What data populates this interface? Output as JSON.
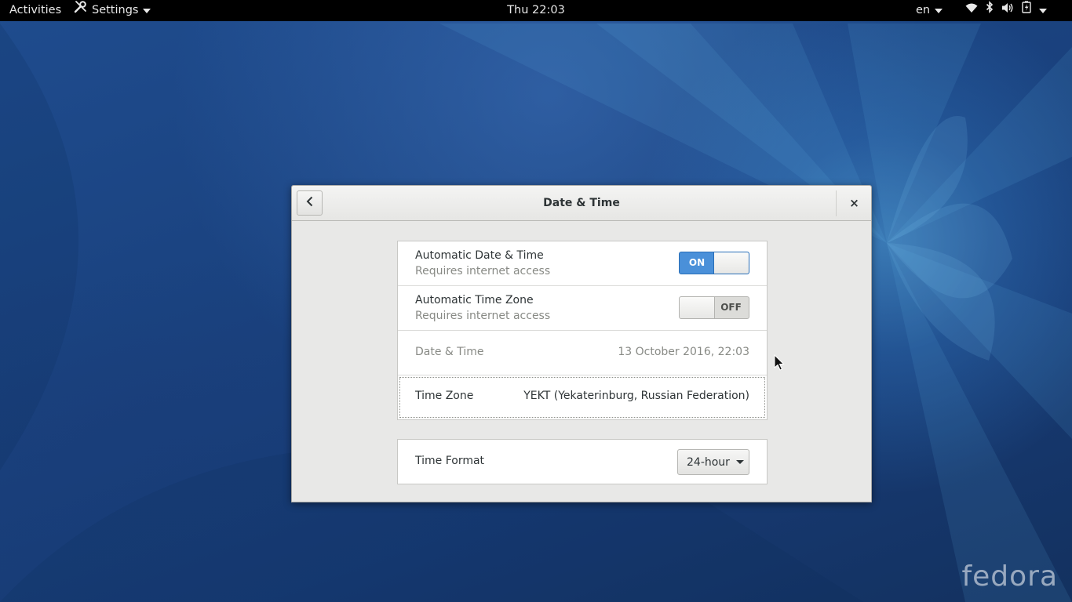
{
  "topbar": {
    "activities": "Activities",
    "app_menu": "Settings",
    "clock": "Thu 22:03",
    "language": "en",
    "tray_icons": [
      "wifi-icon",
      "bluetooth-icon",
      "volume-icon",
      "battery-icon",
      "system-menu-arrow-icon"
    ]
  },
  "dialog": {
    "title": "Date & Time",
    "back_icon": "chevron-left-icon",
    "close_icon": "close-icon",
    "close_label": "×",
    "rows": {
      "auto_datetime": {
        "title": "Automatic Date & Time",
        "subtitle": "Requires internet access",
        "switch_label": "ON",
        "state": true
      },
      "auto_timezone": {
        "title": "Automatic Time Zone",
        "subtitle": "Requires internet access",
        "switch_label": "OFF",
        "state": false
      },
      "datetime": {
        "title": "Date & Time",
        "value": "13 October 2016, 22:03"
      },
      "timezone": {
        "title": "Time Zone",
        "value": "YEKT (Yekaterinburg, Russian Federation)"
      }
    },
    "time_format": {
      "title": "Time Format",
      "selected": "24-hour"
    }
  },
  "desktop": {
    "logo_text": "fedora"
  },
  "colors": {
    "switch_on": "#4a90d9",
    "topbar": "#000000",
    "dialog_bg": "#e8e8e7"
  }
}
